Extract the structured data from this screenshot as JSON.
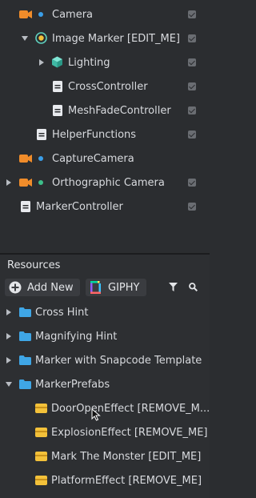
{
  "hierarchy": {
    "items": [
      {
        "label": "Camera"
      },
      {
        "label": "Image Marker [EDIT_ME]"
      },
      {
        "label": "Lighting"
      },
      {
        "label": "CrossController"
      },
      {
        "label": "MeshFadeController"
      },
      {
        "label": "HelperFunctions"
      },
      {
        "label": "CaptureCamera"
      },
      {
        "label": "Orthographic Camera"
      },
      {
        "label": "MarkerController"
      }
    ]
  },
  "resources": {
    "title": "Resources",
    "add_new_label": "Add New",
    "giphy_label": "GIPHY",
    "items": [
      {
        "label": "Cross Hint"
      },
      {
        "label": "Magnifying Hint"
      },
      {
        "label": "Marker with Snapcode Template"
      },
      {
        "label": "MarkerPrefabs"
      },
      {
        "label": "DoorOpenEffect [REMOVE_M..."
      },
      {
        "label": "ExplosionEffect [REMOVE_ME]"
      },
      {
        "label": "Mark The Monster [EDIT_ME]"
      },
      {
        "label": "PlatformEffect [REMOVE_ME]"
      }
    ]
  },
  "colors": {
    "camera_orange": "#f08c2a",
    "dot_blue": "#3a9ee8",
    "dot_green": "#3dbf8a",
    "folder_blue": "#3fa6e6",
    "prefab_yellow": "#f3c13a",
    "lighting_teal": "#5fd3c0"
  }
}
